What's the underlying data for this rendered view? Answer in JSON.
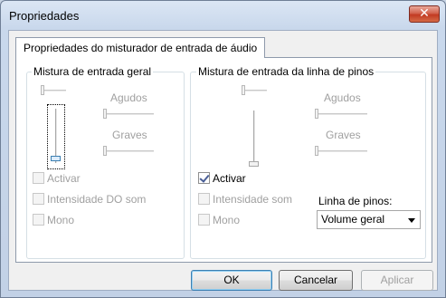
{
  "window": {
    "title": "Propriedades",
    "close_glyph": "✕"
  },
  "tab": {
    "label": "Propriedades do misturador de entrada de áudio"
  },
  "general_group": {
    "caption": "Mistura de entrada geral",
    "treble_label": "Agudos",
    "bass_label": "Graves",
    "activate_label": "Activar",
    "activate_checked": false,
    "loudness_label": "Intensidade DO som",
    "mono_label": "Mono",
    "enabled": false
  },
  "pin_group": {
    "caption": "Mistura de entrada da linha de pinos",
    "treble_label": "Agudos",
    "bass_label": "Graves",
    "activate_label": "Activar",
    "activate_checked": true,
    "loudness_label": "Intensidade som",
    "mono_label": "Mono",
    "pin_line_label": "Linha de pinos:",
    "pin_line_selected": "Volume geral"
  },
  "buttons": {
    "ok": "OK",
    "cancel": "Cancelar",
    "apply": "Aplicar"
  },
  "colors": {
    "accent": "#3c7fb1",
    "close": "#c23a22",
    "disabled_text": "#a0a0a0"
  }
}
